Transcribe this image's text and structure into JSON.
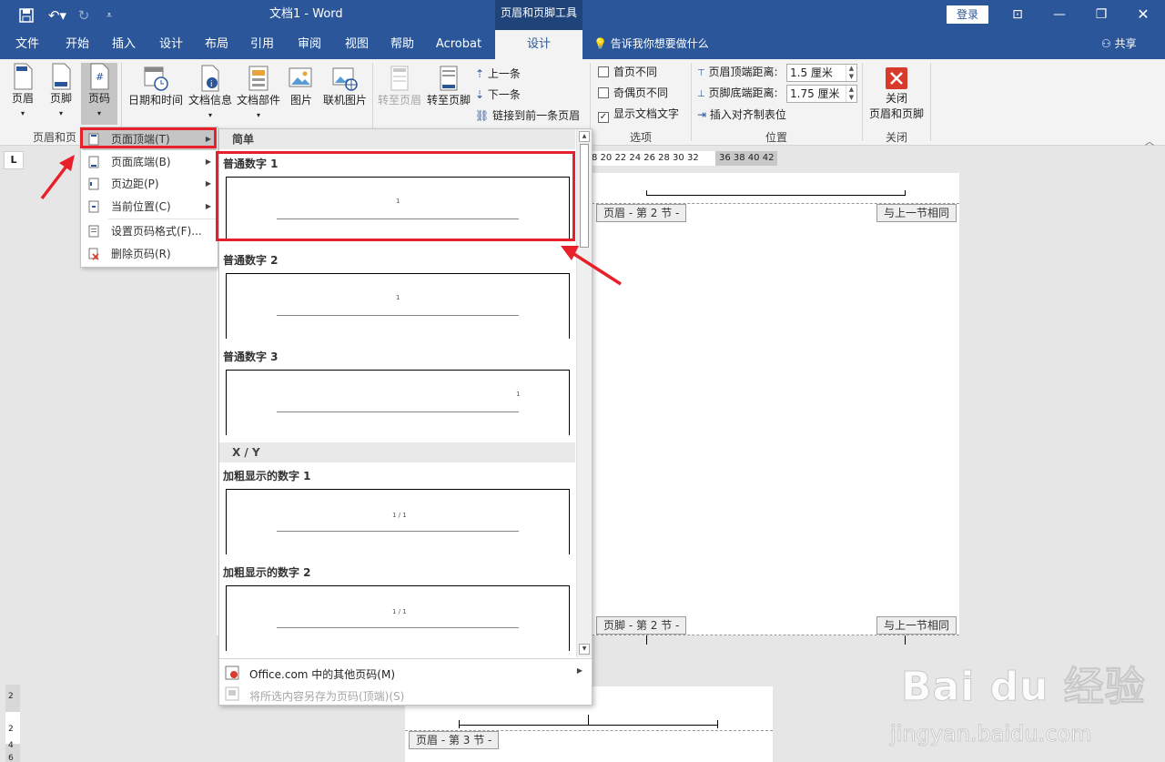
{
  "title_bar": {
    "doc_title": "文档1  -  Word",
    "context_tools": "页眉和页脚工具",
    "login": "登录"
  },
  "tabs": [
    "文件",
    "开始",
    "插入",
    "设计",
    "布局",
    "引用",
    "审阅",
    "视图",
    "帮助",
    "Acrobat",
    "设计"
  ],
  "active_tab": "设计",
  "tell_me": "告诉我你想要做什么",
  "share": "共享",
  "ribbon": {
    "header": "页眉",
    "footer": "页脚",
    "page_number": "页码",
    "group_hf": "页眉和页",
    "datetime": "日期和时间",
    "docinfo": "文档信息",
    "quickparts": "文档部件",
    "picture": "图片",
    "online_picture": "联机图片",
    "goto_header": "转至页眉",
    "goto_footer": "转至页脚",
    "prev": "上一条",
    "next": "下一条",
    "link_prev": "链接到前一条页眉",
    "opt_first": "首页不同",
    "opt_oddeven": "奇偶页不同",
    "opt_showtext": "显示文档文字",
    "group_options": "选项",
    "header_dist_label": "页眉顶端距离:",
    "header_dist_value": "1.5 厘米",
    "footer_dist_label": "页脚底端距离:",
    "footer_dist_value": "1.75 厘米",
    "insert_tab": "插入对齐制表位",
    "group_position": "位置",
    "close_line1": "关闭",
    "close_line2": "页眉和页脚",
    "group_close": "关闭"
  },
  "ruler_numbers": "8  20  22  24  26  28  30  32",
  "ruler_numbers_grey": "36  38  40  42",
  "ruler_corner": "L",
  "page_tags": {
    "header_sec2": "页眉 - 第 2 节 -",
    "same_as_prev": "与上一节相同",
    "footer_sec2": "页脚 - 第 2 节 -",
    "header_sec3": "页眉 - 第 3 节 -"
  },
  "vruler": [
    "2",
    "2",
    "4",
    "6"
  ],
  "menu": [
    {
      "label": "页面顶端(T)",
      "sub": true
    },
    {
      "label": "页面底端(B)",
      "sub": true
    },
    {
      "label": "页边距(P)",
      "sub": true
    },
    {
      "label": "当前位置(C)",
      "sub": true
    },
    {
      "label": "设置页码格式(F)...",
      "sub": false
    },
    {
      "label": "删除页码(R)",
      "sub": false
    }
  ],
  "gallery": {
    "cat_simple": "简单",
    "cat_xy": "X / Y",
    "items": [
      {
        "title": "普通数字 1",
        "num": "1"
      },
      {
        "title": "普通数字 2",
        "num": "1"
      },
      {
        "title": "普通数字 3",
        "num": "1"
      },
      {
        "title": "加粗显示的数字 1",
        "num": "1 / 1"
      },
      {
        "title": "加粗显示的数字 2",
        "num": "1 / 1"
      }
    ],
    "more": "Office.com 中的其他页码(M)",
    "save": "将所选内容另存为页码(顶端)(S)"
  },
  "watermark": {
    "main": "Bai du 经验",
    "sub": "jingyan.baidu.com"
  }
}
